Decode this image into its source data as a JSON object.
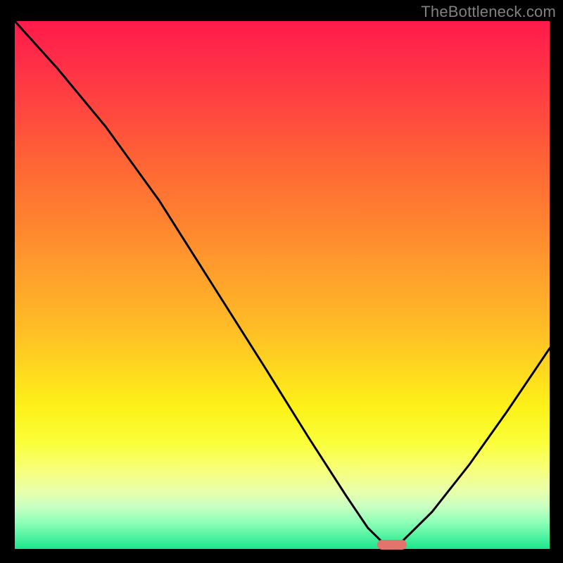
{
  "watermark": "TheBottleneck.com",
  "chart_data": {
    "type": "line",
    "title": "",
    "xlabel": "",
    "ylabel": "",
    "xlim": [
      0,
      100
    ],
    "ylim": [
      0,
      100
    ],
    "grid": false,
    "background_gradient": {
      "top_color": "#ff1a4b",
      "bottom_color": "#1be68d",
      "description": "red (high bottleneck) to green (optimal)"
    },
    "series": [
      {
        "name": "bottleneck-curve",
        "color": "#000000",
        "x": [
          0,
          8,
          17,
          27,
          37,
          47,
          55,
          62,
          66,
          69,
          72,
          78,
          85,
          92,
          100
        ],
        "y": [
          100,
          91,
          80,
          66,
          50,
          34,
          21,
          10,
          4,
          1,
          1,
          7,
          16,
          26,
          38
        ]
      }
    ],
    "annotations": [
      {
        "name": "optimal-marker",
        "type": "pill",
        "color": "#e2736d",
        "x_center": 70.5,
        "y": 0.8,
        "width": 5.5
      }
    ]
  }
}
